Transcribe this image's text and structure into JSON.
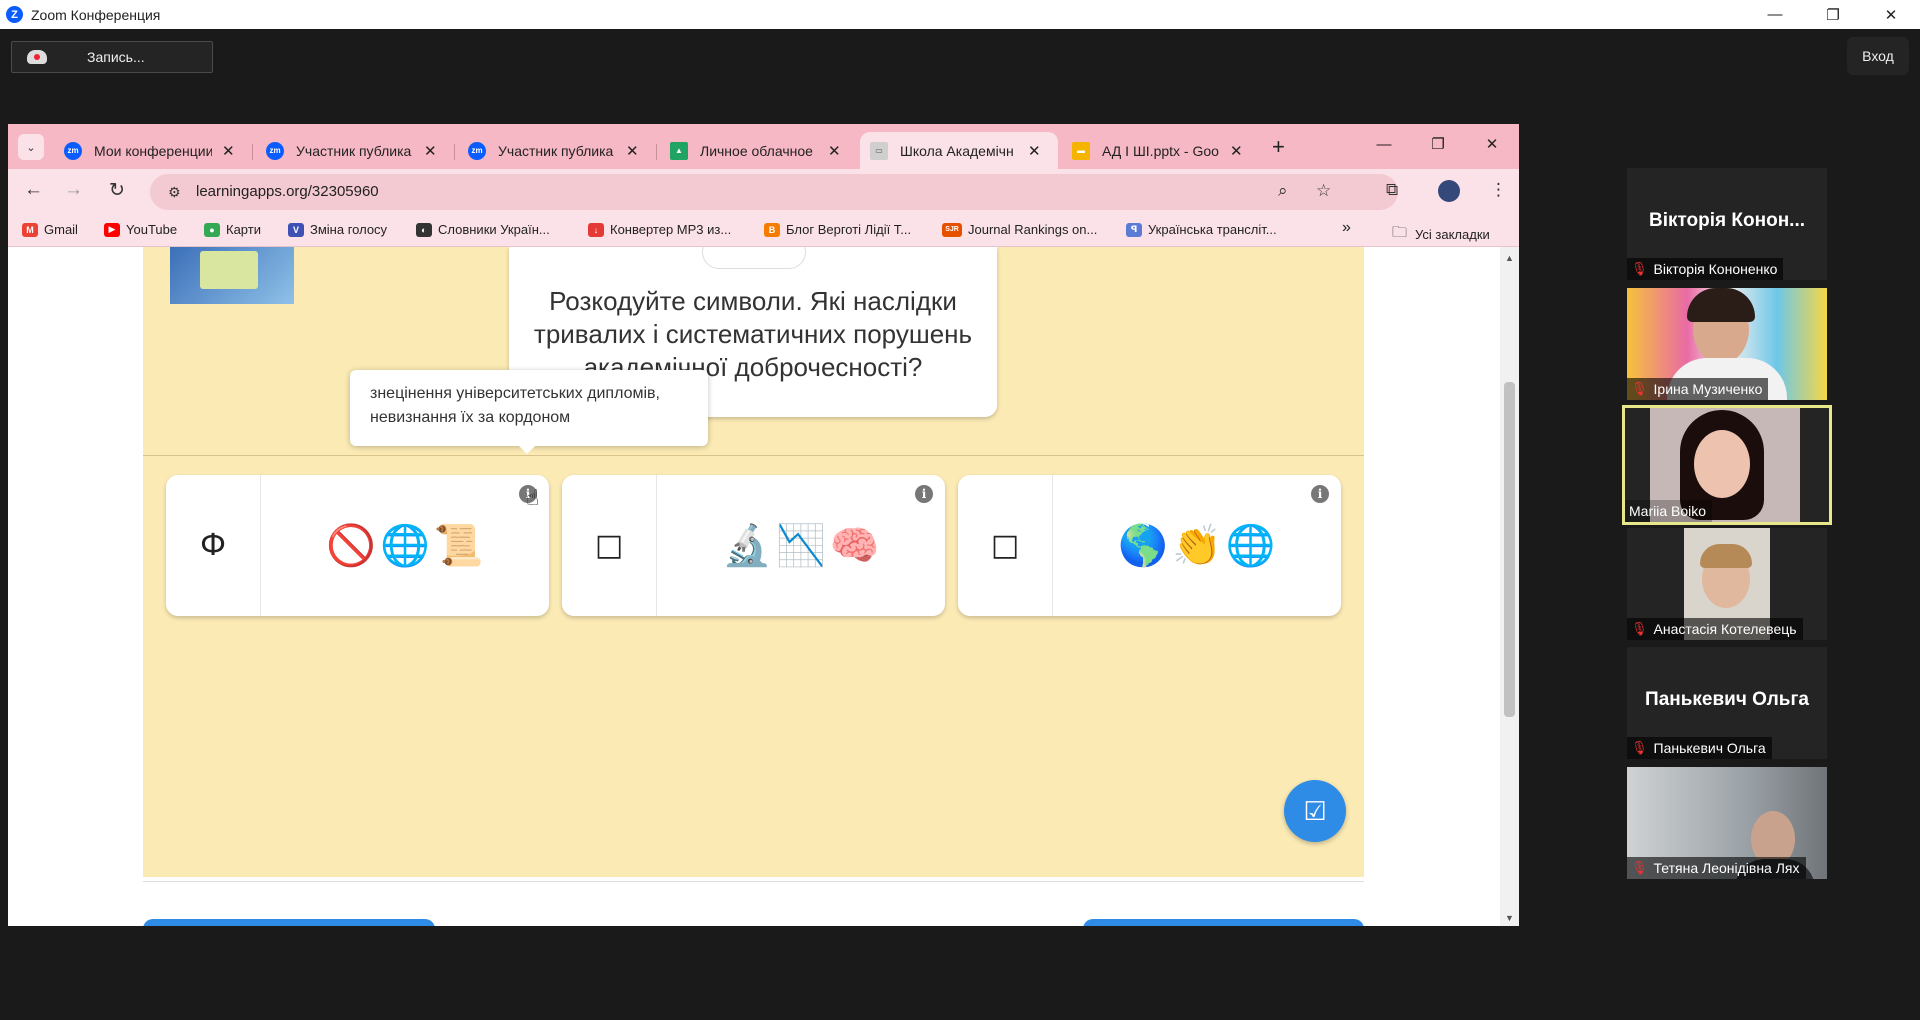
{
  "zoom": {
    "title": "Zoom Конференция",
    "logo": "Z",
    "record_label": "Запись...",
    "enter_label": "Вход",
    "window_controls": [
      "—",
      "❐",
      "✕"
    ]
  },
  "chrome": {
    "tabs": [
      {
        "label": "Мои конференции",
        "favicon": "zm",
        "color": "#0b5cff"
      },
      {
        "label": "Участник публика",
        "favicon": "zm",
        "color": "#0b5cff"
      },
      {
        "label": "Участник публика",
        "favicon": "zm",
        "color": "#0b5cff"
      },
      {
        "label": "Личное облачное",
        "favicon": "drive",
        "color": "#1fa463"
      },
      {
        "label": "Школа Академічн",
        "favicon": "la",
        "color": "#888888",
        "active": true
      },
      {
        "label": "АД І ШІ.pptx - Goo",
        "favicon": "slides",
        "color": "#f4b400"
      }
    ],
    "new_tab": "+",
    "window_controls": [
      "—",
      "❐",
      "✕"
    ],
    "url": "learningapps.org/32305960",
    "bookmarks": [
      {
        "label": "Gmail",
        "icon": "M",
        "color": "#ea4335"
      },
      {
        "label": "YouTube",
        "icon": "▶",
        "color": "#ff0000"
      },
      {
        "label": "Карти",
        "icon": "●",
        "color": "#34a853"
      },
      {
        "label": "Зміна голосу",
        "icon": "V",
        "color": "#3f51b5"
      },
      {
        "label": "Словники Україн...",
        "icon": "◐",
        "color": "#333333"
      },
      {
        "label": "Конвертер MP3 из...",
        "icon": "↓",
        "color": "#e53935"
      },
      {
        "label": "Блог Верготі Лідії Т...",
        "icon": "B",
        "color": "#f57c00"
      },
      {
        "label": "Journal Rankings on...",
        "icon": "SJR",
        "color": "#e65100"
      },
      {
        "label": "Українська трансліт...",
        "icon": "ꟼ",
        "color": "#5b7bd5"
      }
    ],
    "more_bookmarks": "»",
    "all_bookmarks": "Усі закладки"
  },
  "app": {
    "question": "Розкодуйте символи. Які наслідки тривалих і систематичних пору­шень академічної доброчесності?",
    "tooltip": "знецінення університетських дипломів, невизнання їх за кордоном",
    "answers": [
      {
        "slot": "Ф",
        "emojis": [
          "🚫",
          "🌐",
          "📜"
        ]
      },
      {
        "slot": "□",
        "emojis": [
          "🔬",
          "📉",
          "🧠"
        ]
      },
      {
        "slot": "□",
        "emojis": [
          "🌎",
          "👏",
          "🌐"
        ]
      }
    ],
    "check_icon": "☑"
  },
  "participants": [
    {
      "name": "Вікторія Кононенко",
      "big_name": "Вікторія Конон...",
      "video": false
    },
    {
      "name": "Ірина Музиченко",
      "video": true
    },
    {
      "name": "Mariia Boiko",
      "video": true,
      "active": true,
      "muted": false
    },
    {
      "name": "Анастасія Котелевець",
      "video": true
    },
    {
      "name": "Панькевич Ольга",
      "big_name": "Панькевич Ольга",
      "video": false
    },
    {
      "name": "Тетяна Леонідівна Лях",
      "video": true
    }
  ]
}
